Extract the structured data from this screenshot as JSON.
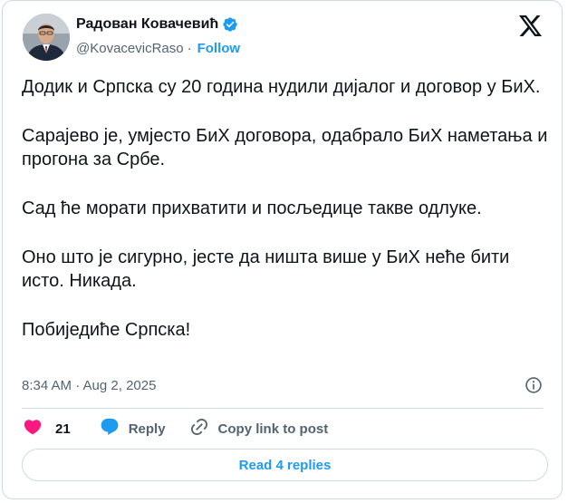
{
  "author": {
    "name": "Радован Ковачевић",
    "handle": "@KovacevicRaso",
    "follow_label": "Follow",
    "separator": "·"
  },
  "tweet": {
    "paragraphs": [
      "Додик и Српска су 20 година нудили дијалог и договор у БиХ.",
      "Сарајево је, умјесто БиХ договора, одабрало БиХ наметања и прогона за Србе.",
      "Сад ће морати прихватити и посљедице такве одлуке.",
      "Оно што је сигурно, јесте да ништа више у БиХ неће бити исто. Никада.",
      "Побиједиће Српска!"
    ],
    "timestamp": "8:34 AM · Aug 2, 2025"
  },
  "actions": {
    "like_count": "21",
    "reply_label": "Reply",
    "copy_label": "Copy link to post"
  },
  "read_replies_label": "Read 4 replies",
  "icons": {
    "verified": "verified-badge-icon",
    "logo": "x-logo-icon",
    "info": "info-icon",
    "like": "heart-icon",
    "reply": "reply-bubble-icon",
    "copy": "link-icon"
  },
  "colors": {
    "accent": "#1d9bf0",
    "like": "#f91880",
    "text": "#0f1419",
    "muted": "#536471",
    "border": "#cfd9de"
  }
}
